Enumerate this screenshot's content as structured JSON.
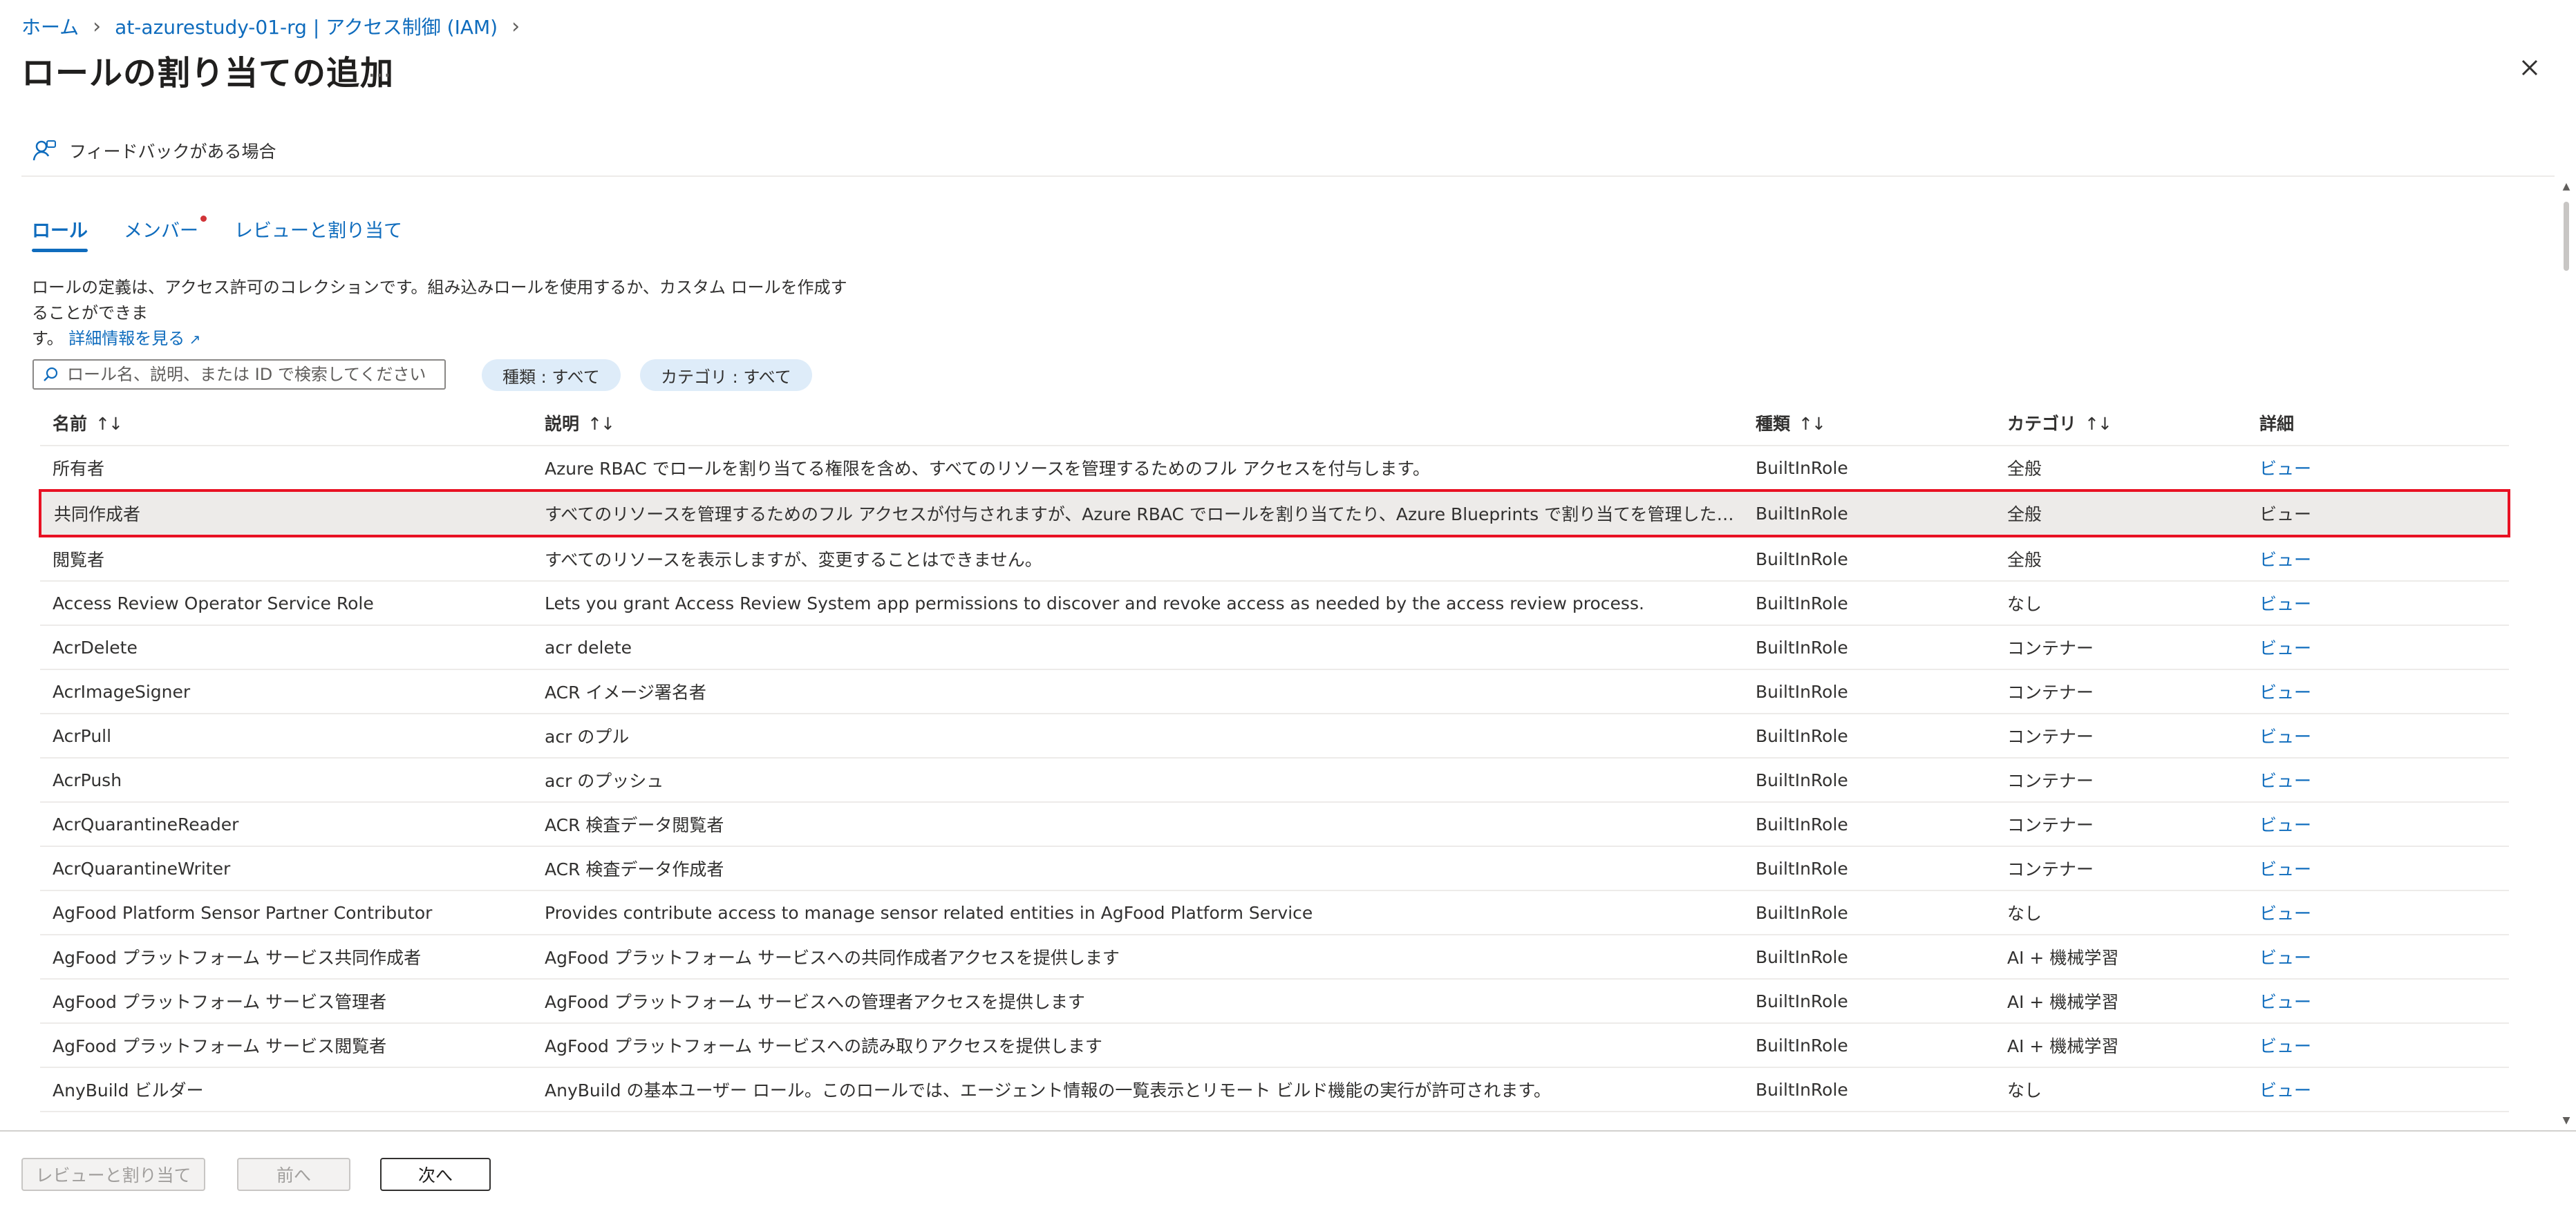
{
  "breadcrumb": [
    "ホーム",
    "at-azurestudy-01-rg | アクセス制御 (IAM)"
  ],
  "title": "ロールの割り当ての追加",
  "more": "…",
  "feedback": "フィードバックがある場合",
  "tabs": [
    "ロール",
    "メンバー",
    "レビューと割り当て"
  ],
  "description": {
    "line1": "ロールの定義は、アクセス許可のコレクションです。組み込みロールを使用するか、カスタム ロールを作成することができま",
    "line2": "す。",
    "link": "詳細情報を見る"
  },
  "search": {
    "placeholder": "ロール名、説明、または ID で検索してください"
  },
  "filters": [
    "種類 : すべて",
    "カテゴリ : すべて"
  ],
  "table": {
    "headers": {
      "name": "名前",
      "desc": "説明",
      "type": "種類",
      "category": "カテゴリ",
      "details": "詳細"
    },
    "sort_glyph": "↑↓",
    "rows": [
      {
        "name": "所有者",
        "desc": "Azure RBAC でロールを割り当てる権限を含め、すべてのリソースを管理するためのフル アクセスを付与します。",
        "type": "BuiltInRole",
        "category": "全般",
        "view": "ビュー"
      },
      {
        "name": "共同作成者",
        "desc": "すべてのリソースを管理するためのフル アクセスが付与されますが、Azure RBAC でロールを割り当てたり、Azure Blueprints で割り当てを管理したり、イメージ ギャラリーを共...",
        "type": "BuiltInRole",
        "category": "全般",
        "view": "ビュー"
      },
      {
        "name": "閲覧者",
        "desc": "すべてのリソースを表示しますが、変更することはできません。",
        "type": "BuiltInRole",
        "category": "全般",
        "view": "ビュー"
      },
      {
        "name": "Access Review Operator Service Role",
        "desc": "Lets you grant Access Review System app permissions to discover and revoke access as needed by the access review process.",
        "type": "BuiltInRole",
        "category": "なし",
        "view": "ビュー"
      },
      {
        "name": "AcrDelete",
        "desc": "acr delete",
        "type": "BuiltInRole",
        "category": "コンテナー",
        "view": "ビュー"
      },
      {
        "name": "AcrImageSigner",
        "desc": "ACR イメージ署名者",
        "type": "BuiltInRole",
        "category": "コンテナー",
        "view": "ビュー"
      },
      {
        "name": "AcrPull",
        "desc": "acr のプル",
        "type": "BuiltInRole",
        "category": "コンテナー",
        "view": "ビュー"
      },
      {
        "name": "AcrPush",
        "desc": "acr のプッシュ",
        "type": "BuiltInRole",
        "category": "コンテナー",
        "view": "ビュー"
      },
      {
        "name": "AcrQuarantineReader",
        "desc": "ACR 検査データ閲覧者",
        "type": "BuiltInRole",
        "category": "コンテナー",
        "view": "ビュー"
      },
      {
        "name": "AcrQuarantineWriter",
        "desc": "ACR 検査データ作成者",
        "type": "BuiltInRole",
        "category": "コンテナー",
        "view": "ビュー"
      },
      {
        "name": "AgFood Platform Sensor Partner Contributor",
        "desc": "Provides contribute access to manage sensor related entities in AgFood Platform Service",
        "type": "BuiltInRole",
        "category": "なし",
        "view": "ビュー"
      },
      {
        "name": "AgFood プラットフォーム サービス共同作成者",
        "desc": "AgFood プラットフォーム サービスへの共同作成者アクセスを提供します",
        "type": "BuiltInRole",
        "category": "AI + 機械学習",
        "view": "ビュー"
      },
      {
        "name": "AgFood プラットフォーム サービス管理者",
        "desc": "AgFood プラットフォーム サービスへの管理者アクセスを提供します",
        "type": "BuiltInRole",
        "category": "AI + 機械学習",
        "view": "ビュー"
      },
      {
        "name": "AgFood プラットフォーム サービス閲覧者",
        "desc": "AgFood プラットフォーム サービスへの読み取りアクセスを提供します",
        "type": "BuiltInRole",
        "category": "AI + 機械学習",
        "view": "ビュー"
      },
      {
        "name": "AnyBuild ビルダー",
        "desc": "AnyBuild の基本ユーザー ロール。このロールでは、エージェント情報の一覧表示とリモート ビルド機能の実行が許可されます。",
        "type": "BuiltInRole",
        "category": "なし",
        "view": "ビュー"
      }
    ]
  },
  "footer": {
    "review": "レビューと割り当て",
    "prev": "前へ",
    "next": "次へ"
  }
}
